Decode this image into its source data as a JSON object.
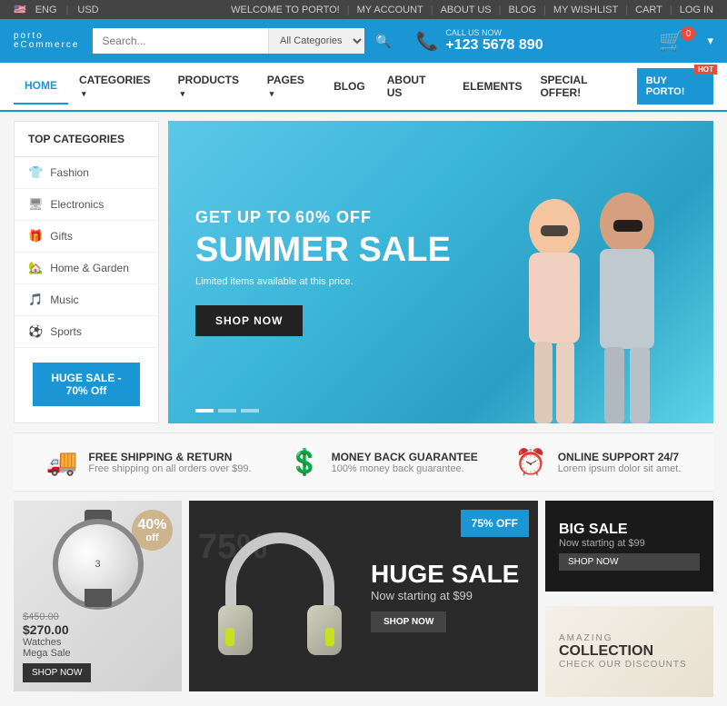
{
  "topbar": {
    "lang": "ENG",
    "currency": "USD",
    "links": [
      "WELCOME TO PORTO!",
      "MY ACCOUNT",
      "ABOUT US",
      "BLOG",
      "MY WISHLIST",
      "CART",
      "LOG IN"
    ]
  },
  "header": {
    "logo_main": "porto",
    "logo_sub": "eCommerce",
    "search_placeholder": "Search...",
    "search_cat": "All Categories",
    "phone_label": "CALL US NOW",
    "phone_number": "+123 5678 890",
    "cart_count": "0"
  },
  "nav": {
    "items": [
      {
        "label": "HOME",
        "active": true,
        "has_arrow": false
      },
      {
        "label": "CATEGORIES",
        "active": false,
        "has_arrow": true
      },
      {
        "label": "PRODUCTS",
        "active": false,
        "has_arrow": true
      },
      {
        "label": "PAGES",
        "active": false,
        "has_arrow": true
      },
      {
        "label": "BLOG",
        "active": false,
        "has_arrow": false
      },
      {
        "label": "ABOUT US",
        "active": false,
        "has_arrow": false
      },
      {
        "label": "ELEMENTS",
        "active": false,
        "has_arrow": false
      }
    ],
    "special_offer": "SPECIAL OFFER!",
    "buy_porto": "BUY PORTO!",
    "hot_badge": "HOT"
  },
  "sidebar": {
    "title": "TOP CATEGORIES",
    "items": [
      {
        "label": "Fashion",
        "icon": "👕"
      },
      {
        "label": "Electronics",
        "icon": "🖥"
      },
      {
        "label": "Gifts",
        "icon": "🎁"
      },
      {
        "label": "Home & Garden",
        "icon": "🏡"
      },
      {
        "label": "Music",
        "icon": "🎵"
      },
      {
        "label": "Sports",
        "icon": "⚽"
      }
    ],
    "sale_btn": "HUGE SALE - 70% Off"
  },
  "hero": {
    "subtitle_pre": "GET UP TO",
    "subtitle_pct": "60% OFF",
    "title": "SUMMER SALE",
    "desc": "Limited items available at this price.",
    "btn": "SHOP NOW"
  },
  "features": [
    {
      "icon": "🚚",
      "title": "FREE SHIPPING & RETURN",
      "desc": "Free shipping on all orders over $99."
    },
    {
      "icon": "💲",
      "title": "MONEY BACK GUARANTEE",
      "desc": "100% money back guarantee."
    },
    {
      "icon": "⏰",
      "title": "ONLINE SUPPORT 24/7",
      "desc": "Lorem ipsum dolor sit amet."
    }
  ],
  "promo": {
    "watches": {
      "badge_pct": "40%",
      "badge_off": "off",
      "price_old": "$450.00",
      "price_new": "$270.00",
      "label": "Watches",
      "sublabel": "Mega Sale",
      "btn": "SHOP NOW"
    },
    "headphones": {
      "badge": "75% OFF",
      "bg_num": "75%",
      "title": "HUGE SALE",
      "subtitle": "Now starting at $99",
      "btn": "SHOP NOW"
    },
    "bigsale": {
      "title": "BIG SALE",
      "sub": "Now starting at $99",
      "btn": "SHOP NOW"
    },
    "collection": {
      "label": "AMAZING",
      "title": "COLLECTION",
      "sub": "CHECK OUR DISCOUNTS"
    }
  }
}
